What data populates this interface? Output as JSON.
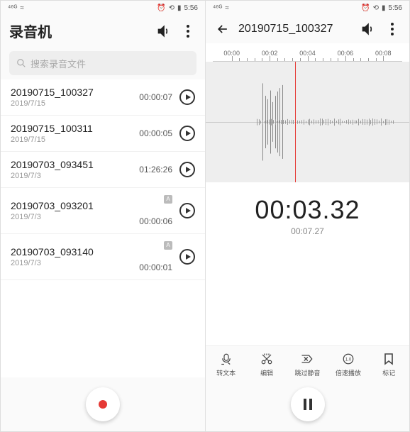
{
  "statusbar": {
    "signal": "⁴⁶ᴳ",
    "wifi": "≈",
    "alarm": "⏰",
    "battery": "▮",
    "time": "5:56"
  },
  "left": {
    "title": "录音机",
    "search_placeholder": "搜索录音文件",
    "recordings": [
      {
        "name": "20190715_100327",
        "date": "2019/7/15",
        "duration": "00:00:07",
        "badge": false
      },
      {
        "name": "20190715_100311",
        "date": "2019/7/15",
        "duration": "00:00:05",
        "badge": false
      },
      {
        "name": "20190703_093451",
        "date": "2019/7/3",
        "duration": "01:26:26",
        "badge": false
      },
      {
        "name": "20190703_093201",
        "date": "2019/7/3",
        "duration": "00:00:06",
        "badge": true
      },
      {
        "name": "20190703_093140",
        "date": "2019/7/3",
        "duration": "00:00:01",
        "badge": true
      }
    ]
  },
  "right": {
    "title": "20190715_100327",
    "ruler_ticks": [
      "00:00",
      "00:02",
      "00:04",
      "00:06",
      "00:08"
    ],
    "current_time": "00:03.32",
    "total_time": "00:07.27",
    "tools": {
      "transcribe": "转文本",
      "edit": "编辑",
      "skip_silence": "跳过静音",
      "speed": "倍速播放",
      "bookmark": "标记"
    }
  }
}
